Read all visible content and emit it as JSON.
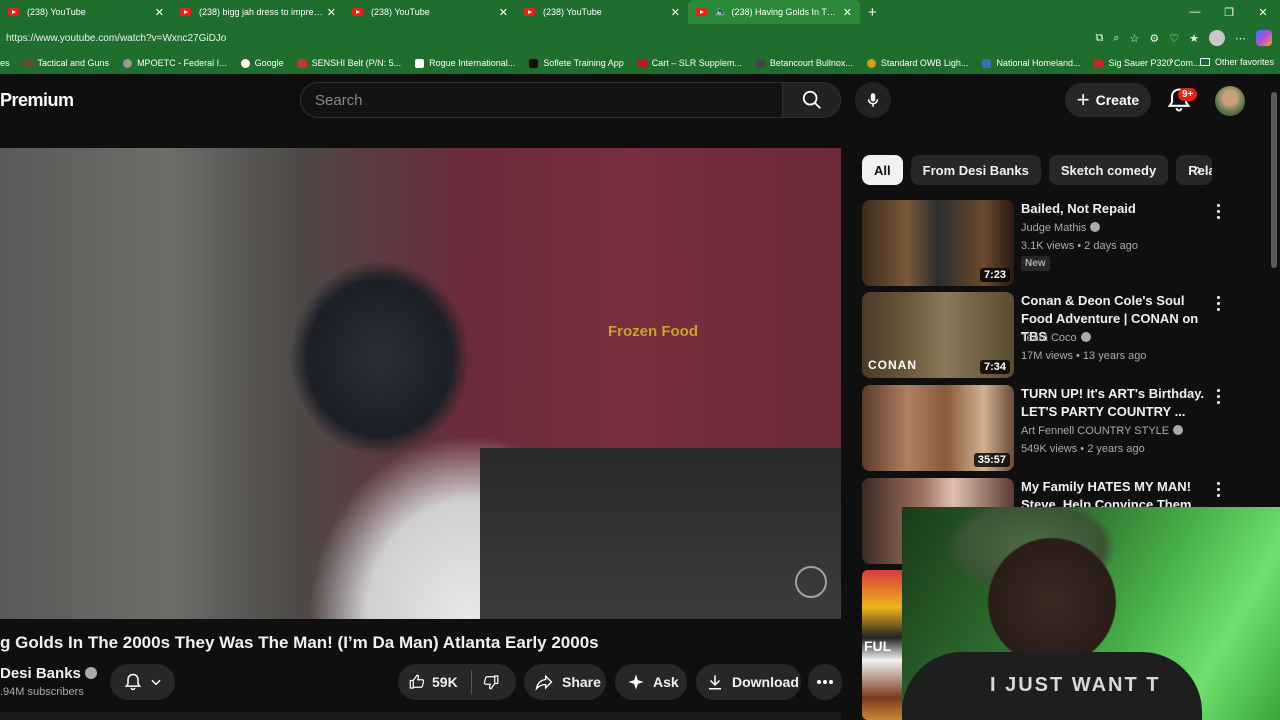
{
  "browser": {
    "tabs": [
      {
        "title": "(238) YouTube",
        "active": false
      },
      {
        "title": "(238) bigg jah dress to impress - Y",
        "active": false
      },
      {
        "title": "(238) YouTube",
        "active": false
      },
      {
        "title": "(238) YouTube",
        "active": false
      },
      {
        "title": "(238) Having Golds In The 20",
        "active": true
      }
    ],
    "url": "https://www.youtube.com/watch?v=Wxnc27GiDJo",
    "bookmarks": [
      {
        "label": "es",
        "color": "#3a3a3a"
      },
      {
        "label": "Tactical and Guns",
        "color": "#6b4a2a"
      },
      {
        "label": "MPOETC - Federal I...",
        "color": "#999999"
      },
      {
        "label": "Google",
        "color": "#4285f4"
      },
      {
        "label": "SENSHI Belt (P/N: 5...",
        "color": "#c0392b"
      },
      {
        "label": "Rogue International...",
        "color": "#222222"
      },
      {
        "label": "Soflete Training App",
        "color": "#2d2d2d"
      },
      {
        "label": "Cart – SLR Supplem...",
        "color": "#b71c1c"
      },
      {
        "label": "Betancourt Bullnox...",
        "color": "#444444"
      },
      {
        "label": "Standard OWB Ligh...",
        "color": "#d4a017"
      },
      {
        "label": "National Homeland...",
        "color": "#3a6fb0"
      },
      {
        "label": "Sig Sauer P320 Com...",
        "color": "#c62828"
      }
    ],
    "other_favorites": "Other favorites"
  },
  "header": {
    "logo_text": "Premium",
    "search_placeholder": "Search",
    "create_label": "Create",
    "notification_count": "9+"
  },
  "video": {
    "overlay_sign": "Frozen Food",
    "title": "g Golds In The 2000s They Was The Man! (I’m Da Man) Atlanta Early 2000s",
    "channel": "Desi Banks",
    "subscribers": ".94M subscribers",
    "likes": "59K",
    "share_label": "Share",
    "ask_label": "Ask",
    "download_label": "Download"
  },
  "chips": [
    "All",
    "From Desi Banks",
    "Sketch comedy",
    "Rela"
  ],
  "recommendations": [
    {
      "title": "Bailed, Not Repaid",
      "channel": "Judge Mathis",
      "meta": "3.1K views • 2 days ago",
      "duration": "7:23",
      "badge": "New"
    },
    {
      "title": "Conan & Deon Cole's Soul Food Adventure | CONAN on TBS",
      "channel": "Team Coco",
      "meta": "17M views • 13 years ago",
      "duration": "7:34",
      "overlay": "CONAN"
    },
    {
      "title": "TURN UP! It's ART's Birthday. LET'S PARTY COUNTRY ...",
      "channel": "Art Fennell COUNTRY STYLE",
      "meta": "549K views • 2 years ago",
      "duration": "35:57"
    },
    {
      "title": "My Family HATES MY MAN! Steve, Help Convince Them"
    }
  ],
  "side_strip_text": "FUL",
  "webcam_shirt_text": "I JUST WANT T"
}
